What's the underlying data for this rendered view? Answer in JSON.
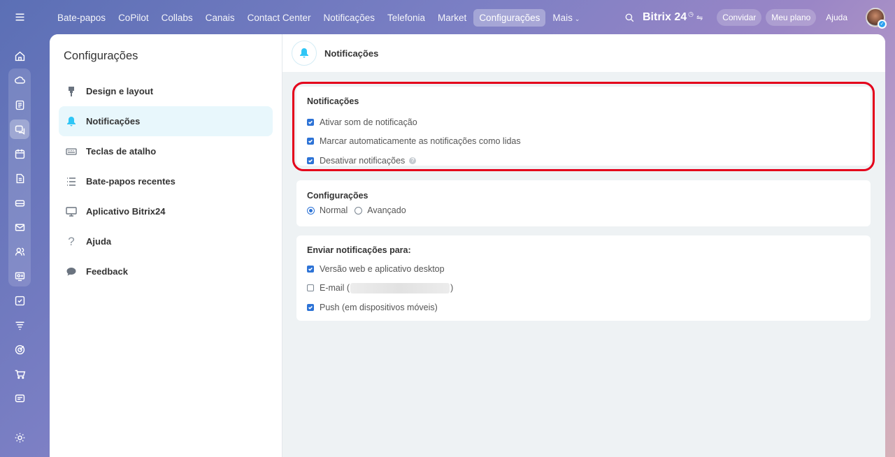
{
  "topnav": {
    "items": [
      "Bate-papos",
      "CoPilot",
      "Collabs",
      "Canais",
      "Contact Center",
      "Notificações",
      "Telefonia",
      "Market",
      "Configurações",
      "Mais"
    ],
    "active_index": 8
  },
  "topright": {
    "logo": "Bitrix 24",
    "invite": "Convidar",
    "plan": "Meu plano",
    "help": "Ajuda"
  },
  "settings": {
    "title": "Configurações",
    "nav": [
      {
        "label": "Design e layout",
        "icon": "brush-icon"
      },
      {
        "label": "Notificações",
        "icon": "bell-icon"
      },
      {
        "label": "Teclas de atalho",
        "icon": "keyboard-icon"
      },
      {
        "label": "Bate-papos recentes",
        "icon": "list-icon"
      },
      {
        "label": "Aplicativo Bitrix24",
        "icon": "monitor-icon"
      },
      {
        "label": "Ajuda",
        "icon": "question-icon"
      },
      {
        "label": "Feedback",
        "icon": "chat-bubble-icon"
      }
    ],
    "active_nav_index": 1
  },
  "content": {
    "header_title": "Notificações",
    "notif_card": {
      "title": "Notificações",
      "options": [
        {
          "label": "Ativar som de notificação",
          "checked": true
        },
        {
          "label": "Marcar automaticamente as notificações como lidas",
          "checked": true
        },
        {
          "label": "Desativar notificações",
          "checked": true,
          "help": "?"
        }
      ]
    },
    "config_card": {
      "title": "Configurações",
      "radio_normal": "Normal",
      "radio_advanced": "Avançado",
      "selected": "Normal"
    },
    "send_card": {
      "title": "Enviar notificações para:",
      "options": [
        {
          "label": "Versão web e aplicativo desktop",
          "checked": true
        },
        {
          "label_prefix": "E-mail (",
          "label_suffix": ")",
          "checked": false
        },
        {
          "label": "Push (em dispositivos móveis)",
          "checked": true
        }
      ]
    }
  }
}
